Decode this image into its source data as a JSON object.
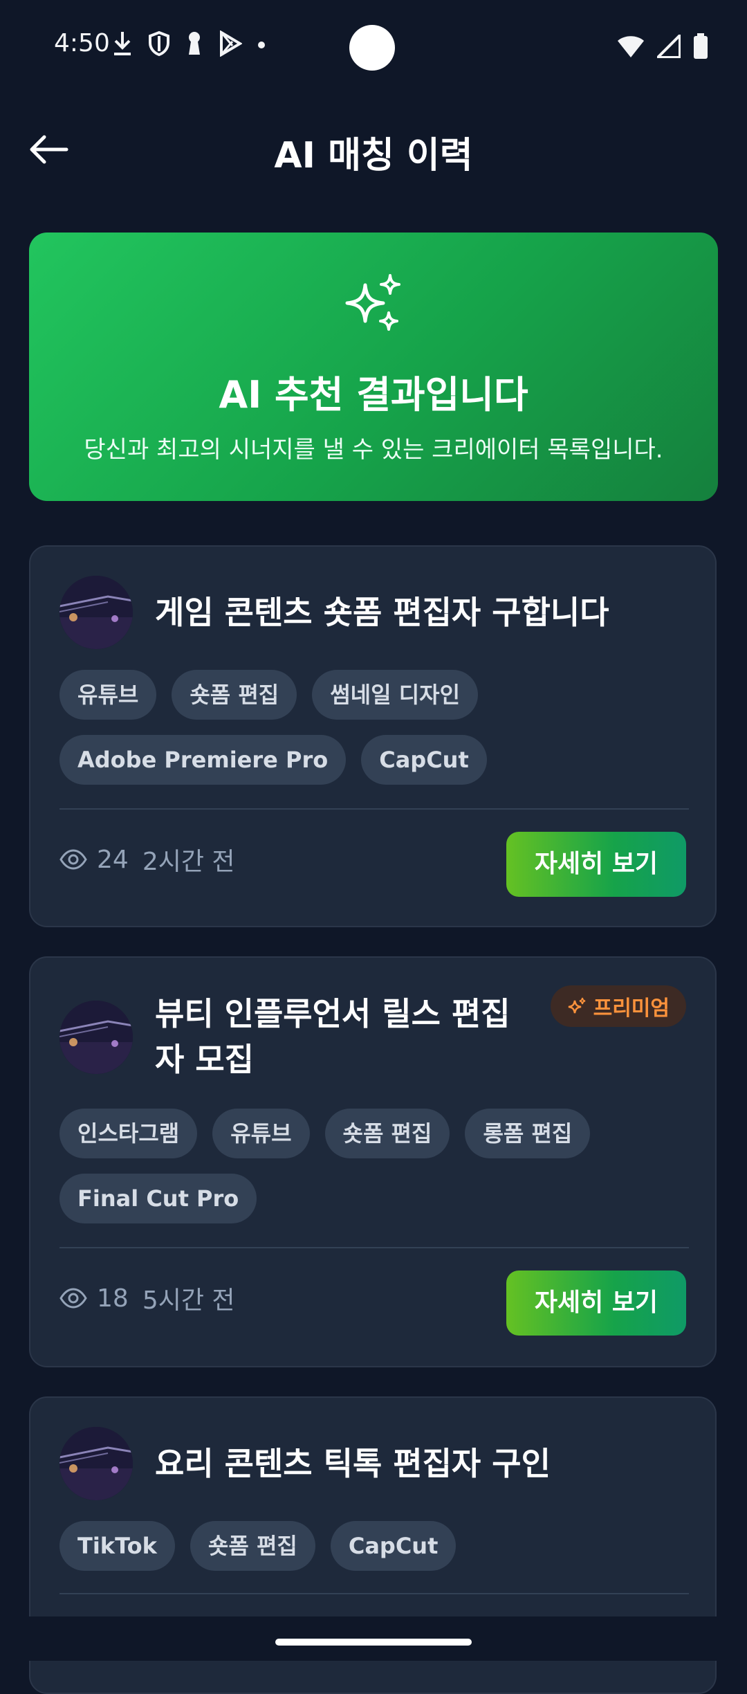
{
  "status_bar": {
    "time": "4:50"
  },
  "app_bar": {
    "title": "AI 매칭 이력"
  },
  "hero": {
    "title": "AI 추천 결과입니다",
    "subtitle": "당신과 최고의 시너지를 낼 수 있는 크리에이터 목록입니다."
  },
  "cards": [
    {
      "title": "게임 콘텐츠 숏폼 편집자 구합니다",
      "tags": [
        "유튜브",
        "숏폼 편집",
        "썸네일 디자인",
        "Adobe Premiere Pro",
        "CapCut"
      ],
      "views": "24",
      "time": "2시간 전",
      "button": "자세히 보기"
    },
    {
      "title_line1": "뷰티 인플루언서 릴스 편집",
      "title_line2": "자 모집",
      "badge": "프리미엄",
      "tags": [
        "인스타그램",
        "유튜브",
        "숏폼 편집",
        "롱폼 편집",
        "Final Cut Pro"
      ],
      "views": "18",
      "time": "5시간 전",
      "button": "자세히 보기"
    },
    {
      "title": "요리 콘텐츠 틱톡 편집자 구인",
      "tags": [
        "TikTok",
        "숏폼 편집",
        "CapCut"
      ]
    }
  ],
  "icons": {
    "back": "arrow-left-icon",
    "hero": "sparkles-icon",
    "views": "eye-icon",
    "premium": "sparkles-icon"
  },
  "colors": {
    "background": "#0f1728",
    "card": "#1e293b",
    "accent_green": "#22c55e",
    "premium_orange": "#fb923c"
  }
}
